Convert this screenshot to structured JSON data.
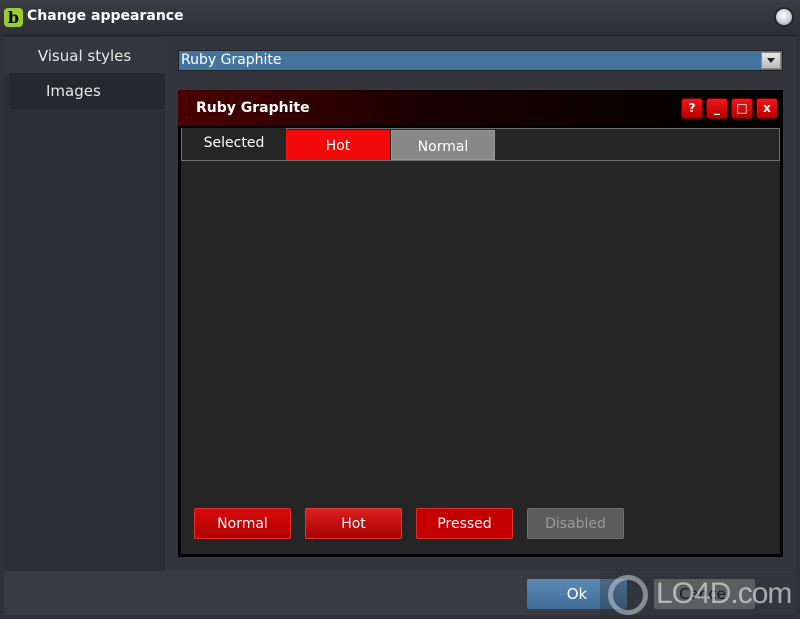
{
  "window": {
    "title": "Change appearance",
    "app_icon_glyph": "b"
  },
  "sidebar": {
    "items": [
      {
        "label": "Visual styles",
        "active": true
      },
      {
        "label": "Images",
        "active": false
      }
    ]
  },
  "style_select": {
    "value": "Ruby Graphite"
  },
  "preview": {
    "title": "Ruby Graphite",
    "window_buttons": [
      "?",
      "_",
      "□",
      "x"
    ],
    "tabs": [
      {
        "label": "Selected",
        "state": "selected"
      },
      {
        "label": "Hot",
        "state": "hot"
      },
      {
        "label": "Normal",
        "state": "normal"
      }
    ],
    "buttons": [
      {
        "label": "Normal",
        "state": "normal"
      },
      {
        "label": "Hot",
        "state": "hot"
      },
      {
        "label": "Pressed",
        "state": "pressed"
      },
      {
        "label": "Disabled",
        "state": "disabled"
      }
    ]
  },
  "footer": {
    "ok_label": "Ok",
    "cancel_label": "Cancel"
  },
  "watermark": {
    "text": "LO4D.com"
  },
  "colors": {
    "accent_blue": "#44759e",
    "ruby_red": "#f20a0a",
    "app_icon_green": "#9acd32"
  }
}
